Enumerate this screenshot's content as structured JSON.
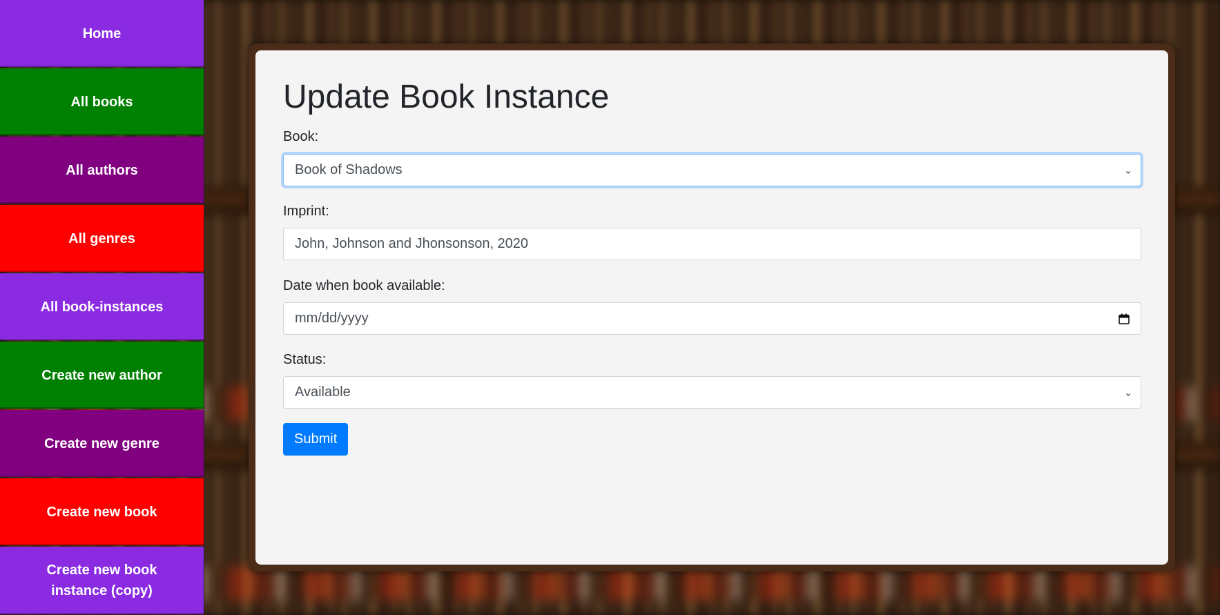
{
  "nav": [
    {
      "label": "Home",
      "color": "#8a2be2"
    },
    {
      "label": "All books",
      "color": "#008000"
    },
    {
      "label": "All authors",
      "color": "#800080"
    },
    {
      "label": "All genres",
      "color": "#ff0000"
    },
    {
      "label": "All book-instances",
      "color": "#8a2be2"
    },
    {
      "label": "Create new author",
      "color": "#008000"
    },
    {
      "label": "Create new genre",
      "color": "#800080"
    },
    {
      "label": "Create new book",
      "color": "#ff0000"
    },
    {
      "label": "Create new book instance (copy)",
      "color": "#8a2be2"
    }
  ],
  "form": {
    "title": "Update Book Instance",
    "book_label": "Book:",
    "book_value": "Book of Shadows",
    "imprint_label": "Imprint:",
    "imprint_value": "John, Johnson and Jhonsonson, 2020",
    "date_label": "Date when book available:",
    "date_placeholder": "mm/dd/yyyy",
    "status_label": "Status:",
    "status_value": "Available",
    "submit_label": "Submit"
  },
  "colors": {
    "primary": "#007bff",
    "card_bg": "#f4f4f4",
    "frame": "#4a2c18"
  }
}
